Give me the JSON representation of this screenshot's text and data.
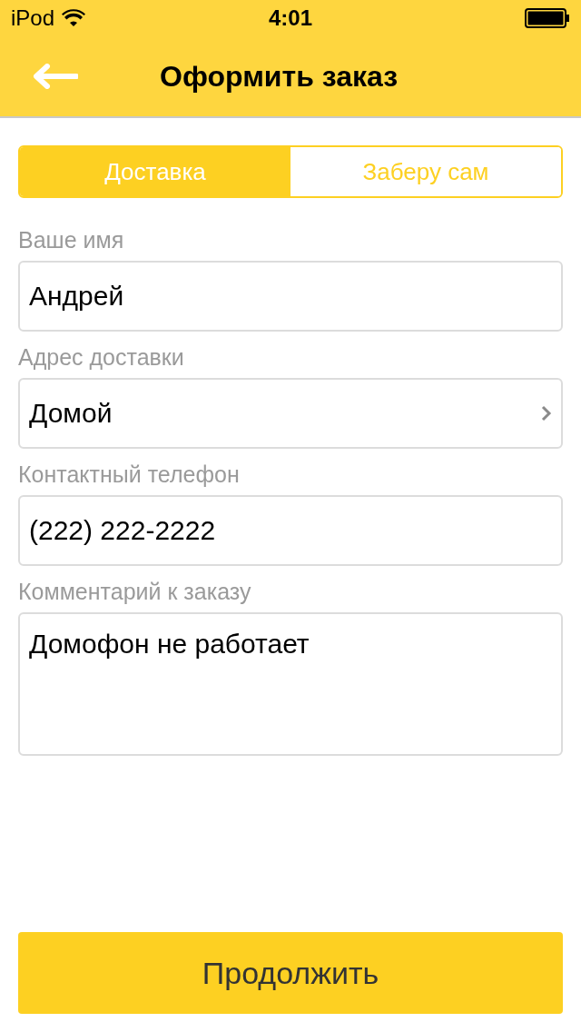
{
  "status_bar": {
    "carrier": "iPod",
    "time": "4:01"
  },
  "header": {
    "title": "Оформить заказ"
  },
  "tabs": [
    {
      "label": "Доставка",
      "selected": true
    },
    {
      "label": "Заберу сам",
      "selected": false
    }
  ],
  "fields": [
    {
      "kind": "text",
      "label": "Ваше имя",
      "value": "Андрей"
    },
    {
      "kind": "select",
      "label": "Адрес доставки",
      "value": "Домой"
    },
    {
      "kind": "text",
      "label": "Контактный телефон",
      "value": "(222) 222-2222"
    },
    {
      "kind": "multiline",
      "label": "Комментарий к заказу",
      "value": "Домофон не работает"
    }
  ],
  "submit": {
    "label": "Продолжить"
  }
}
